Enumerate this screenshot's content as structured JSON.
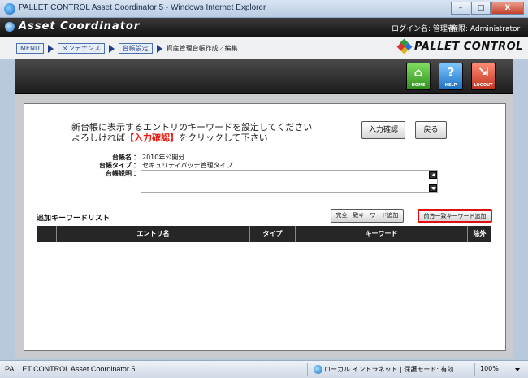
{
  "window": {
    "title": "PALLET CONTROL Asset Coordinator 5 - Windows Internet Explorer",
    "buttons": [
      "–",
      "□",
      "X"
    ]
  },
  "header": {
    "brand": "Asset Coordinator",
    "login_label": "ログイン名: 管理者",
    "auth_label": "権限: Administrator"
  },
  "breadcrumb": {
    "items": [
      "MENU",
      "メンテナンス",
      "台帳設定"
    ],
    "current": "資産管理台帳作成／編集"
  },
  "logo": {
    "text": "PALLET CONTROL"
  },
  "toolbar": {
    "home": {
      "glyph": "⌂",
      "label": "HOME"
    },
    "help": {
      "glyph": "?",
      "label": "HELP"
    },
    "logout": {
      "glyph": "⇲",
      "label": "LOGOUT"
    }
  },
  "message": {
    "line1": "新台帳に表示するエントリのキーワードを設定してください",
    "line2_pre": "よろしければ",
    "line2_highlight": "【入力確認】",
    "line2_post": "をクリックして下さい"
  },
  "buttons": {
    "confirm": "入力確認",
    "back": "戻る",
    "add_exact": "完全一致キーワード追加",
    "add_prefix": "前方一致キーワード追加"
  },
  "fields": {
    "name_label": "台帳名",
    "name_value": "2010年公開分",
    "type_label": "台帳タイプ",
    "type_value": "セキュリティパッチ管理タイプ",
    "desc_label": "台帳説明",
    "desc_value": "",
    "colon": "："
  },
  "keyword_list": {
    "title": "追加キーワードリスト",
    "columns": [
      "",
      "エントリ名",
      "タイプ",
      "キーワード",
      "除外"
    ]
  },
  "statusbar": {
    "left": "PALLET CONTROL Asset Coordinator 5",
    "zone": "ローカル イントラネット | 保護モード: 有効",
    "zoom": "100%"
  }
}
